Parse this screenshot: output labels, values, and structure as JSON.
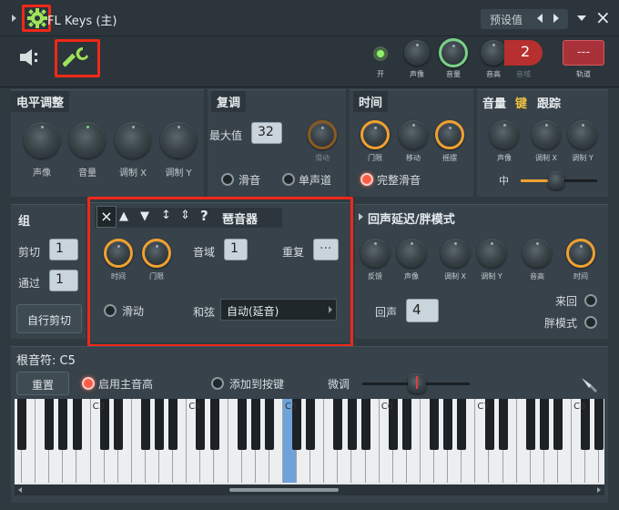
{
  "window": {
    "title": "FL Keys (主)",
    "preset_label": "预设值",
    "close": "×"
  },
  "toolbar": {
    "knobs": [
      {
        "label": "开"
      },
      {
        "label": "声像"
      },
      {
        "label": "音量"
      },
      {
        "label": "音高"
      },
      {
        "label": "音域"
      }
    ],
    "channel_value": "2",
    "track_display": "---",
    "track_label": "轨道"
  },
  "level": {
    "title": "电平调整",
    "knobs": [
      "声像",
      "音量",
      "调制 X",
      "调制 Y"
    ]
  },
  "poly": {
    "title": "复调",
    "max_label": "最大值",
    "max_value": "32",
    "slide_knob_label": "滑动",
    "radio_slide": "滑音",
    "radio_mono": "单声道"
  },
  "time": {
    "title": "时间",
    "knobs": [
      "门限",
      "移动",
      "摇摆"
    ],
    "radio_full": "完整滑音"
  },
  "tracking": {
    "title_vol": "音量",
    "title_key": "键",
    "title_track": "跟踪",
    "knobs": [
      "声像",
      "调制 X",
      "调制 Y"
    ],
    "mid_label": "中"
  },
  "group": {
    "title": "组",
    "cut_label": "剪切",
    "cut_value": "1",
    "pass_label": "通过",
    "pass_value": "1",
    "auto_cut_button": "自行剪切"
  },
  "arp": {
    "title": "琶音器",
    "tool_icons": [
      "×",
      "▲",
      "▼",
      "↕",
      "⇕",
      "?"
    ],
    "knobs": [
      "时间",
      "门限"
    ],
    "range_label": "音域",
    "range_value": "1",
    "repeat_label": "重复",
    "repeat_value": "···",
    "slide_radio": "滑动",
    "chord_label": "和弦",
    "chord_value": "自动(延音)"
  },
  "echo": {
    "title": "回声延迟/胖模式",
    "knobs": [
      "反馈",
      "声像",
      "调制 X",
      "调制 Y",
      "音高",
      "时间"
    ],
    "echo_label": "回声",
    "echo_value": "4",
    "pingpong_label": "来回",
    "fat_label": "胖模式"
  },
  "root": {
    "title": "根音符: C5",
    "reset_button": "重置",
    "main_pitch": "启用主音高",
    "add_key": "添加到按键",
    "fine_tune": "微调"
  },
  "keyboard": {
    "octaves": [
      "C3",
      "C4",
      "C5",
      "C6",
      "C7",
      "C8"
    ]
  },
  "colors": {
    "accent_orange": "#f0a030",
    "accent_green": "#7ad088",
    "highlight_red": "#f02818",
    "key_highlight": "#6fa2d8"
  }
}
